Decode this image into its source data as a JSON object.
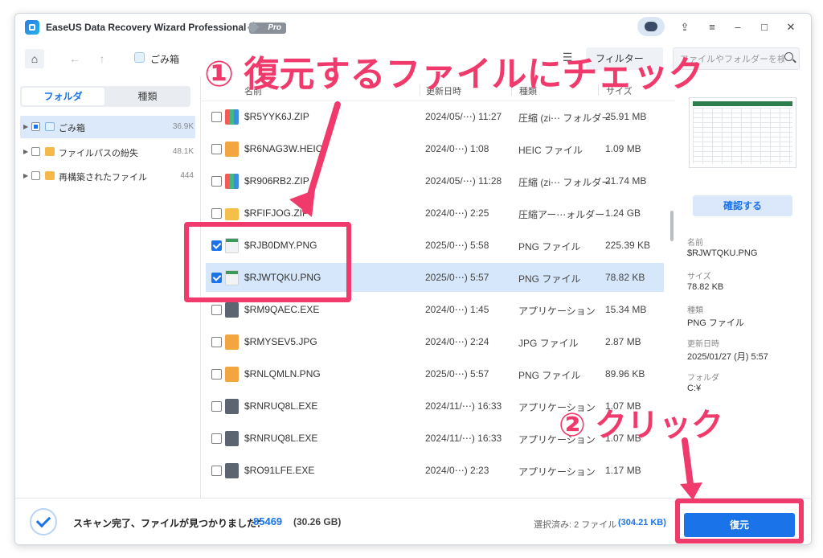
{
  "app": {
    "title": "EaseUS Data Recovery Wizard Professional",
    "badge": "Pro",
    "accent": "#1a73e8"
  },
  "toolbar": {
    "breadcrumb": "ごみ箱",
    "filter_label": "フィルター",
    "search_placeholder": "ファイルやフォルダーを検索"
  },
  "sidebar": {
    "tabs": [
      {
        "label": "フォルダ",
        "active": true
      },
      {
        "label": "種類",
        "active": false
      }
    ],
    "items": [
      {
        "label": "ごみ箱",
        "count": "36.9K",
        "selected": true
      },
      {
        "label": "ファイルパスの紛失",
        "count": "48.1K",
        "selected": false
      },
      {
        "label": "再構築されたファイル",
        "count": "444",
        "selected": false
      }
    ]
  },
  "list": {
    "headers": [
      "名前",
      "更新日時",
      "種類",
      "サイズ"
    ],
    "rows": [
      {
        "name": "$R5YYK6J.ZIP",
        "date": "2024/05/⋯) 11:27",
        "type": "圧縮 (zi⋯ フォルダー",
        "size": "25.91 MB",
        "icon": "zip-icon",
        "checked": false
      },
      {
        "name": "$R6NAG3W.HEIC",
        "date": "2024/0⋯) 1:08",
        "type": "HEIC ファイル",
        "size": "1.09 MB",
        "icon": "image-icon",
        "checked": false
      },
      {
        "name": "$R906RB2.ZIP",
        "date": "2024/05/⋯) 11:28",
        "type": "圧縮 (zi⋯ フォルダー",
        "size": "21.74 MB",
        "icon": "zip-icon",
        "checked": false
      },
      {
        "name": "$RFIFJOG.ZIP",
        "date": "2024/0⋯) 2:25",
        "type": "圧縮アー⋯ォルダー",
        "size": "1.24 GB",
        "icon": "folder-icon",
        "checked": false
      },
      {
        "name": "$RJB0DMY.PNG",
        "date": "2025/0⋯) 5:58",
        "type": "PNG ファイル",
        "size": "225.39 KB",
        "icon": "png-icon",
        "checked": true
      },
      {
        "name": "$RJWTQKU.PNG",
        "date": "2025/0⋯) 5:57",
        "type": "PNG ファイル",
        "size": "78.82 KB",
        "icon": "png-icon",
        "checked": true
      },
      {
        "name": "$RM9QAEC.EXE",
        "date": "2024/0⋯) 1:45",
        "type": "アプリケーション",
        "size": "15.34 MB",
        "icon": "exe-icon",
        "checked": false
      },
      {
        "name": "$RMYSEV5.JPG",
        "date": "2024/0⋯) 2:24",
        "type": "JPG ファイル",
        "size": "2.87 MB",
        "icon": "jpg-icon",
        "checked": false
      },
      {
        "name": "$RNLQMLN.PNG",
        "date": "2025/0⋯) 5:57",
        "type": "PNG ファイル",
        "size": "89.96 KB",
        "icon": "png-orange-icon",
        "checked": false
      },
      {
        "name": "$RNRUQ8L.EXE",
        "date": "2024/11/⋯) 16:33",
        "type": "アプリケーション",
        "size": "1.07 MB",
        "icon": "exe-icon",
        "checked": false
      },
      {
        "name": "$RNRUQ8L.EXE",
        "date": "2024/11/⋯) 16:33",
        "type": "アプリケーション",
        "size": "1.07 MB",
        "icon": "exe-icon",
        "checked": false
      },
      {
        "name": "$RO91LFE.EXE",
        "date": "2024/0⋯) 2:23",
        "type": "アプリケーション",
        "size": "1.17 MB",
        "icon": "exe-icon",
        "checked": false
      }
    ]
  },
  "preview": {
    "confirm_label": "確認する",
    "fields": [
      {
        "label": "名前",
        "value": "$RJWTQKU.PNG"
      },
      {
        "label": "サイズ",
        "value": "78.82 KB"
      },
      {
        "label": "種類",
        "value": "PNG ファイル"
      },
      {
        "label": "更新日時",
        "value": "2025/01/27 (月) 5:57"
      },
      {
        "label": "フォルダ",
        "value": "C:¥"
      }
    ]
  },
  "status": {
    "scan_message": "スキャン完了、ファイルが見つかりました：",
    "file_count": "85469",
    "total_size": "(30.26 GB)",
    "selected_text": "選択済み: 2 ファイル",
    "selected_size": "(304.21 KB)",
    "recover_label": "復元"
  },
  "annotations": {
    "step1": "① 復元するファイルにチェック",
    "step2": "② クリック",
    "color": "#f03a6c"
  }
}
